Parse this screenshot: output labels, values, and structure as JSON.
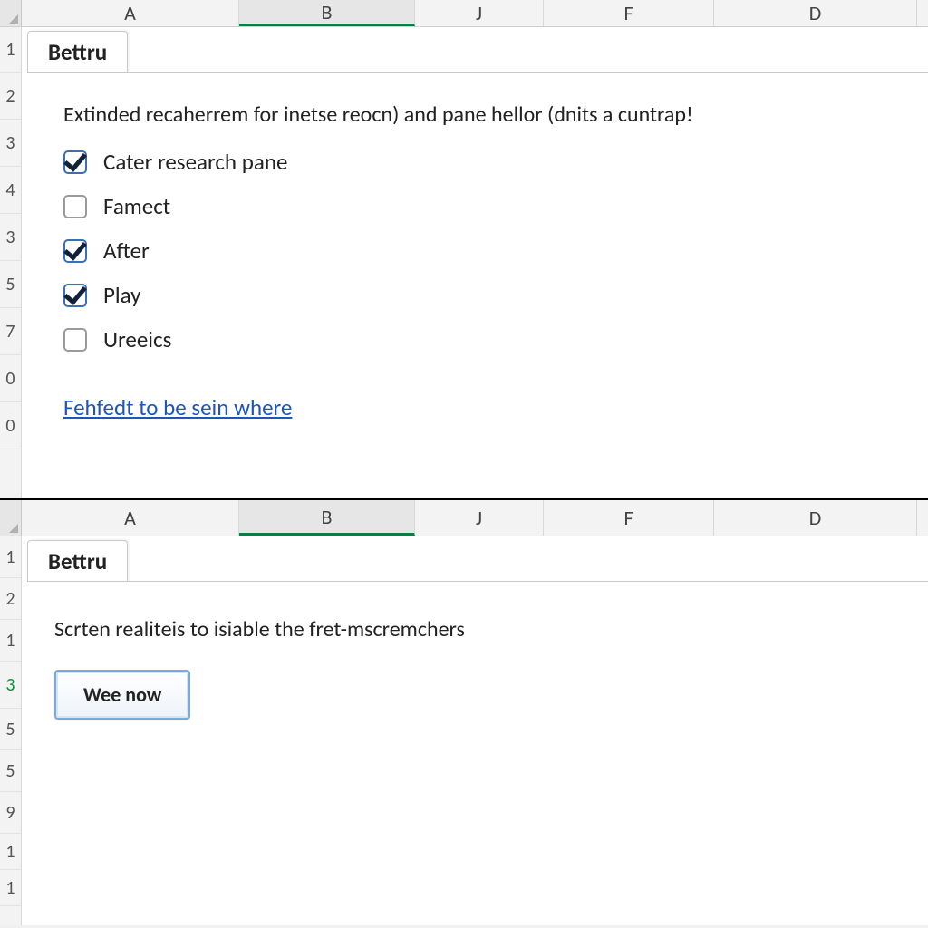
{
  "top": {
    "columns": [
      "A",
      "B",
      "J",
      "F",
      "D"
    ],
    "selected_col_index": 1,
    "rows": [
      "1",
      "2",
      "3",
      "4",
      "3",
      "5",
      "7",
      "0",
      "0"
    ],
    "tab_label": "Bettru",
    "description": "Extinded recaherrem for inetse reocn) and pane hellor (dnits a cuntrap!",
    "checks": [
      {
        "label": "Cater research pane",
        "checked": true
      },
      {
        "label": "Famect",
        "checked": false
      },
      {
        "label": "After",
        "checked": true
      },
      {
        "label": "Play",
        "checked": true
      },
      {
        "label": "Ureeics",
        "checked": false
      }
    ],
    "link_label": "Fehfedt to be sein where"
  },
  "bottom": {
    "columns": [
      "A",
      "B",
      "J",
      "F",
      "D"
    ],
    "selected_col_index": 1,
    "rows": [
      "1",
      "2",
      "1",
      "3",
      "5",
      "5",
      "9",
      "1",
      "1"
    ],
    "selected_row_index": 3,
    "tab_label": "Bettru",
    "description": "Scrten realiteis to isiable the fret-mscremchers",
    "button_label": "Wee now"
  }
}
